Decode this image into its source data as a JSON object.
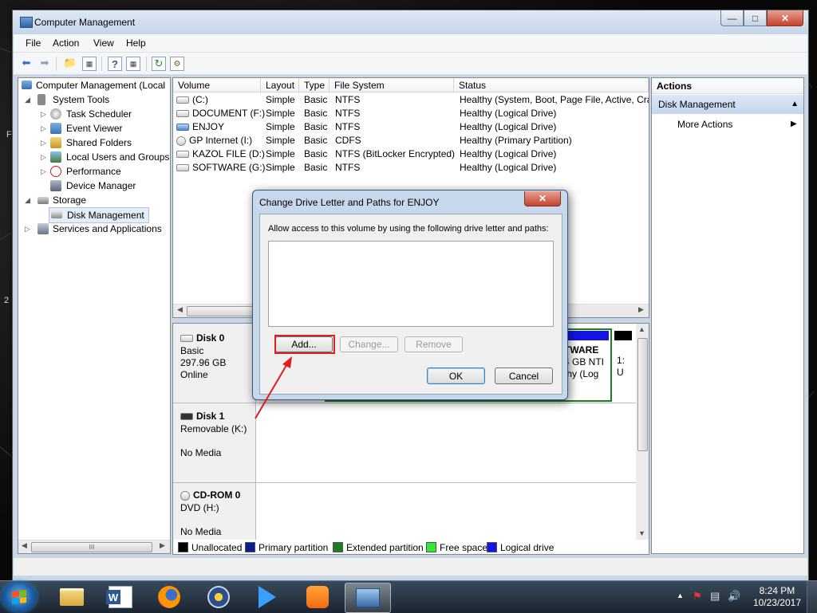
{
  "window": {
    "title": "Computer Management"
  },
  "menu": [
    "File",
    "Action",
    "View",
    "Help"
  ],
  "tree": {
    "root": "Computer Management (Local",
    "items": [
      {
        "label": "System Tools"
      },
      {
        "label": "Task Scheduler"
      },
      {
        "label": "Event Viewer"
      },
      {
        "label": "Shared Folders"
      },
      {
        "label": "Local Users and Groups"
      },
      {
        "label": "Performance"
      },
      {
        "label": "Device Manager"
      },
      {
        "label": "Storage"
      },
      {
        "label": "Disk Management"
      },
      {
        "label": "Services and Applications"
      }
    ],
    "scroll_glyph": "III"
  },
  "volumes": {
    "columns": [
      "Volume",
      "Layout",
      "Type",
      "File System",
      "Status"
    ],
    "rows": [
      {
        "volume": "(C:)",
        "layout": "Simple",
        "type": "Basic",
        "fs": "NTFS",
        "status": "Healthy (System, Boot, Page File, Active, Cras"
      },
      {
        "volume": "DOCUMENT (F:)",
        "layout": "Simple",
        "type": "Basic",
        "fs": "NTFS",
        "status": "Healthy (Logical Drive)"
      },
      {
        "volume": "ENJOY",
        "layout": "Simple",
        "type": "Basic",
        "fs": "NTFS",
        "status": "Healthy (Logical Drive)"
      },
      {
        "volume": "GP Internet (I:)",
        "layout": "Simple",
        "type": "Basic",
        "fs": "CDFS",
        "status": "Healthy (Primary Partition)"
      },
      {
        "volume": "KAZOL FILE (D:)",
        "layout": "Simple",
        "type": "Basic",
        "fs": "NTFS (BitLocker Encrypted)",
        "status": "Healthy (Logical Drive)"
      },
      {
        "volume": "SOFTWARE (G:)",
        "layout": "Simple",
        "type": "Basic",
        "fs": "NTFS",
        "status": "Healthy (Logical Drive)"
      }
    ]
  },
  "disks": [
    {
      "name": "Disk 0",
      "line1": "Basic",
      "line2": "297.96 GB",
      "line3": "Online"
    },
    {
      "name": "Disk 1",
      "line1": "Removable (K:)",
      "line2": "",
      "line3": "No Media"
    },
    {
      "name": "CD-ROM 0",
      "line1": "DVD (H:)",
      "line2": "",
      "line3": "No Media"
    }
  ],
  "disk0_partial": {
    "name": "TWARE",
    "size": "4 GB NTI",
    "status": "thy (Log",
    "c1": "1:",
    "c2": "U"
  },
  "legend": [
    {
      "label": "Unallocated",
      "color": "#000000"
    },
    {
      "label": "Primary partition",
      "color": "#0a1f8f"
    },
    {
      "label": "Extended partition",
      "color": "#1e7d1e"
    },
    {
      "label": "Free space",
      "color": "#33e833"
    },
    {
      "label": "Logical drive",
      "color": "#1414e6"
    }
  ],
  "actions": {
    "header": "Actions",
    "section": "Disk Management",
    "more": "More Actions"
  },
  "dialog": {
    "title": "Change Drive Letter and Paths for ENJOY",
    "instruction": "Allow access to this volume by using the following drive letter and paths:",
    "add": "Add...",
    "change": "Change...",
    "remove": "Remove",
    "ok": "OK",
    "cancel": "Cancel"
  },
  "taskbar": {
    "time": "8:24 PM",
    "date": "10/23/2017"
  },
  "desktop_chars": [
    "F",
    "2"
  ]
}
